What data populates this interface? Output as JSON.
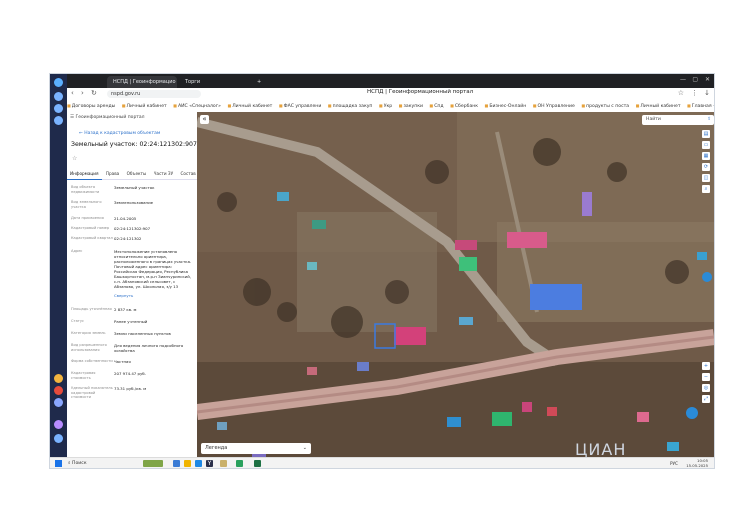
{
  "browser": {
    "tabs": [
      {
        "label": "НСПД | Геоинформацио"
      },
      {
        "label": "Торги"
      }
    ],
    "url": "nspd.gov.ru",
    "page_title": "НСПД | Геоинформационный портал",
    "bookmarks": [
      "Договоры аренды",
      "Личный кабинет",
      "АИС «Спецналог»",
      "Личный кабинет",
      "ФАС управлени",
      "площадка закуп",
      "Укр",
      "закупки",
      "Спд",
      "Сбербанк",
      "Бизнес-Онлайн",
      "ОН Управление",
      "продукты с поста",
      "Личный кабинет",
      "Главная – Неосо"
    ]
  },
  "panel": {
    "header": "Геоинформационный портал",
    "back_link": "Назад к кадастровым объектам",
    "title": "Земельный участок: 02:24:121302:907",
    "tabs": [
      "Информация",
      "Права",
      "Объекты",
      "Части ЗУ",
      "Состав"
    ],
    "rows": [
      {
        "label": "Вид объекта недвижимости",
        "value": "Земельный участок"
      },
      {
        "label": "Вид земельного участка",
        "value": "Землепользование"
      },
      {
        "label": "Дата присвоения",
        "value": "21.04.2005"
      },
      {
        "label": "Кадастровый номер",
        "value": "02:24:121302:907"
      },
      {
        "label": "Кадастровый квартал",
        "value": "02:24:121302"
      },
      {
        "label": "Адрес",
        "value": "Местоположение установлено относительно ориентира, расположенного в границах участка. Почтовый адрес ориентира: Российская Федерация, Республика Башкортостан, м.р-н Зианчуринский, с.п. Абзановский сельсовет, с Абзаново, ул. Школьная, з/у 13",
        "link": "Свернуть"
      },
      {
        "label": "Площадь уточнённая",
        "value": "2 837 кв. м"
      },
      {
        "label": "Статус",
        "value": "Ранее учтенный"
      },
      {
        "label": "Категория земель",
        "value": "Земли населенных пунктов"
      },
      {
        "label": "Вид разрешенного использования",
        "value": "Для ведения личного подсобного хозяйства"
      },
      {
        "label": "Форма собственности",
        "value": "Частная"
      },
      {
        "label": "Кадастровая стоимость",
        "value": "207 974.47 руб."
      },
      {
        "label": "Удельный показатель кадастровой стоимости",
        "value": "73.31 руб./кв. м"
      }
    ]
  },
  "map": {
    "search_label": "Найти",
    "legend_label": "Легенда",
    "colors": {
      "highlight": "#3b7be0",
      "marker": "#2a8bd8"
    }
  },
  "taskbar": {
    "search_label": "Поиск",
    "lang": "РУС",
    "time": "10:05",
    "date": "15.05.2025"
  },
  "watermark": "ЦИАН"
}
